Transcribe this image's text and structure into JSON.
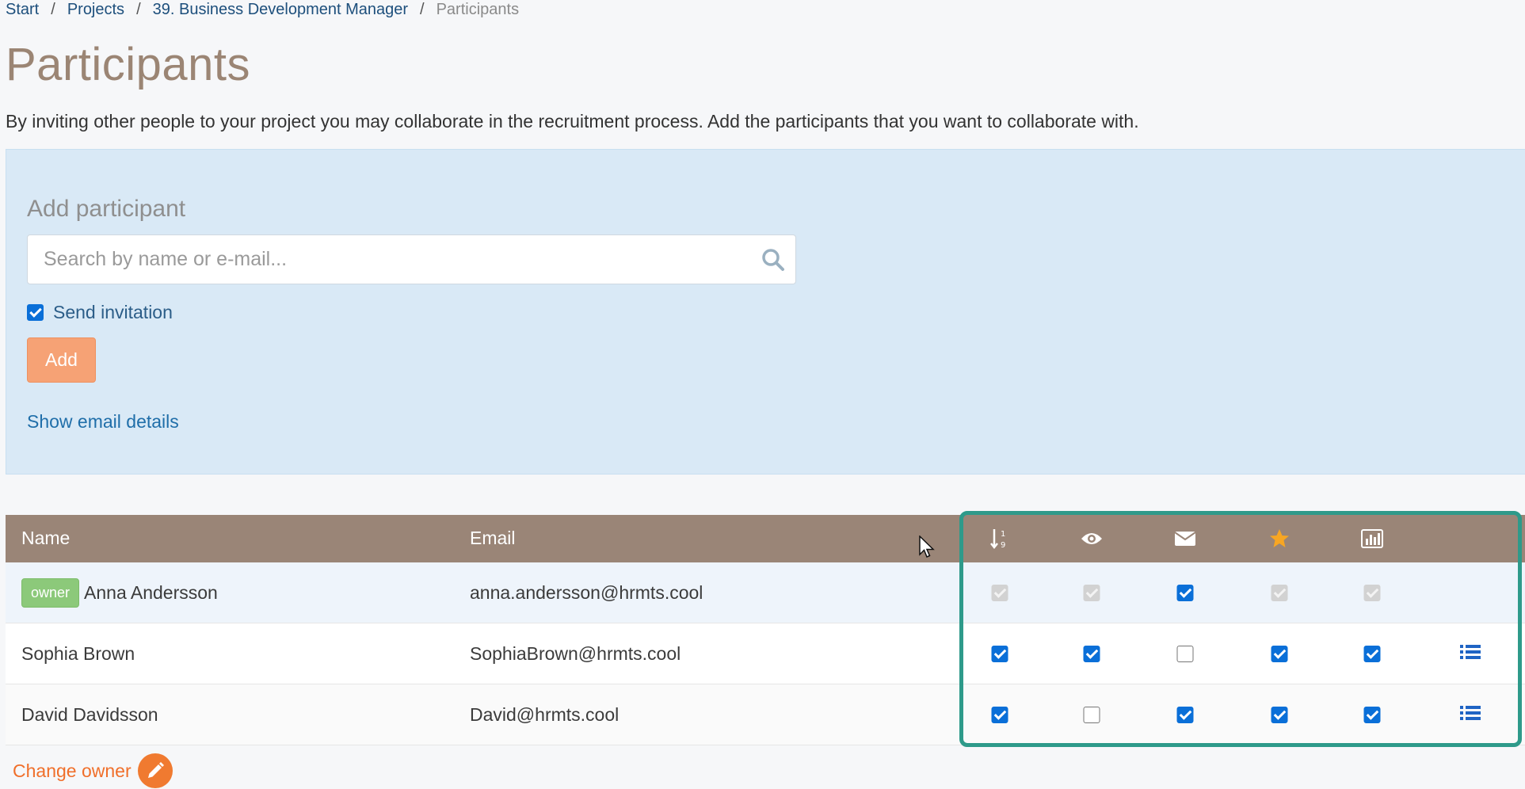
{
  "breadcrumb": {
    "items": [
      "Start",
      "Projects",
      "39. Business Development Manager"
    ],
    "current": "Participants",
    "separator": "/"
  },
  "page": {
    "title": "Participants",
    "intro": "By inviting other people to your project you may collaborate in the recruitment process. Add the participants that you want to collaborate with."
  },
  "add_panel": {
    "title": "Add participant",
    "search_placeholder": "Search by name or e-mail...",
    "search_value": "",
    "send_invitation_label": "Send invitation",
    "send_invitation_checked": true,
    "add_label": "Add",
    "show_email_details_label": "Show email details"
  },
  "table": {
    "headers": {
      "name": "Name",
      "email": "Email"
    },
    "permission_columns": [
      {
        "icon": "sort-numeric-icon"
      },
      {
        "icon": "eye-icon"
      },
      {
        "icon": "envelope-icon"
      },
      {
        "icon": "star-icon"
      },
      {
        "icon": "bar-chart-icon"
      }
    ],
    "rows": [
      {
        "badge": "owner",
        "name": "Anna Andersson",
        "email": "anna.andersson@hrmts.cool",
        "permissions": [
          "disabled",
          "disabled",
          "checked",
          "disabled",
          "disabled"
        ],
        "has_list_icon": false
      },
      {
        "badge": "",
        "name": "Sophia Brown",
        "email": "SophiaBrown@hrmts.cool",
        "permissions": [
          "checked",
          "checked",
          "unchecked",
          "checked",
          "checked"
        ],
        "has_list_icon": true
      },
      {
        "badge": "",
        "name": "David Davidsson",
        "email": "David@hrmts.cool",
        "permissions": [
          "checked",
          "unchecked",
          "checked",
          "checked",
          "checked"
        ],
        "has_list_icon": true
      }
    ]
  },
  "footer": {
    "change_owner_label": "Change owner"
  },
  "colors": {
    "header_bg": "#9a8577",
    "panel_bg": "#d9e9f6",
    "accent_orange": "#f07a30",
    "checkbox_blue": "#0a6fd8",
    "highlight_teal": "#2e9a8a"
  }
}
